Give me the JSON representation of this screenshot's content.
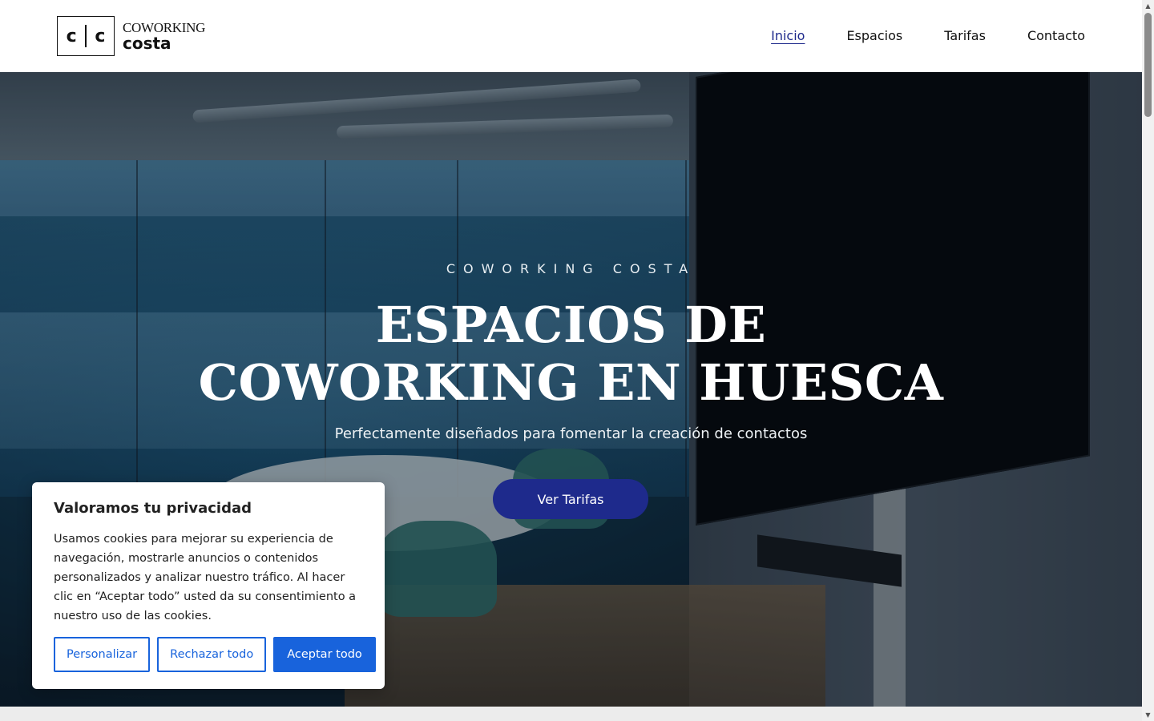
{
  "header": {
    "logo": {
      "mark_left": "c",
      "mark_right": "c",
      "line1": "COWORKING",
      "line2": "costa"
    },
    "nav": [
      {
        "label": "Inicio",
        "active": true
      },
      {
        "label": "Espacios",
        "active": false
      },
      {
        "label": "Tarifas",
        "active": false
      },
      {
        "label": "Contacto",
        "active": false
      }
    ]
  },
  "hero": {
    "eyebrow": "COWORKING COSTA",
    "title_line1": "ESPACIOS DE",
    "title_line2": "COWORKING EN HUESCA",
    "subtitle": "Perfectamente diseñados para fomentar la creación de contactos",
    "cta_label": "Ver Tarifas"
  },
  "cookie_banner": {
    "title": "Valoramos tu privacidad",
    "body": "Usamos cookies para mejorar su experiencia de navegación, mostrarle anuncios o contenidos personalizados y analizar nuestro tráfico. Al hacer clic en “Aceptar todo” usted da su consentimiento a nuestro uso de las cookies.",
    "customize_label": "Personalizar",
    "reject_label": "Rechazar todo",
    "accept_label": "Aceptar todo"
  },
  "colors": {
    "brand_blue": "#1e2a8c",
    "cookie_blue": "#1863dc"
  },
  "icons": [
    "chevron-up-icon",
    "chevron-down-icon"
  ]
}
